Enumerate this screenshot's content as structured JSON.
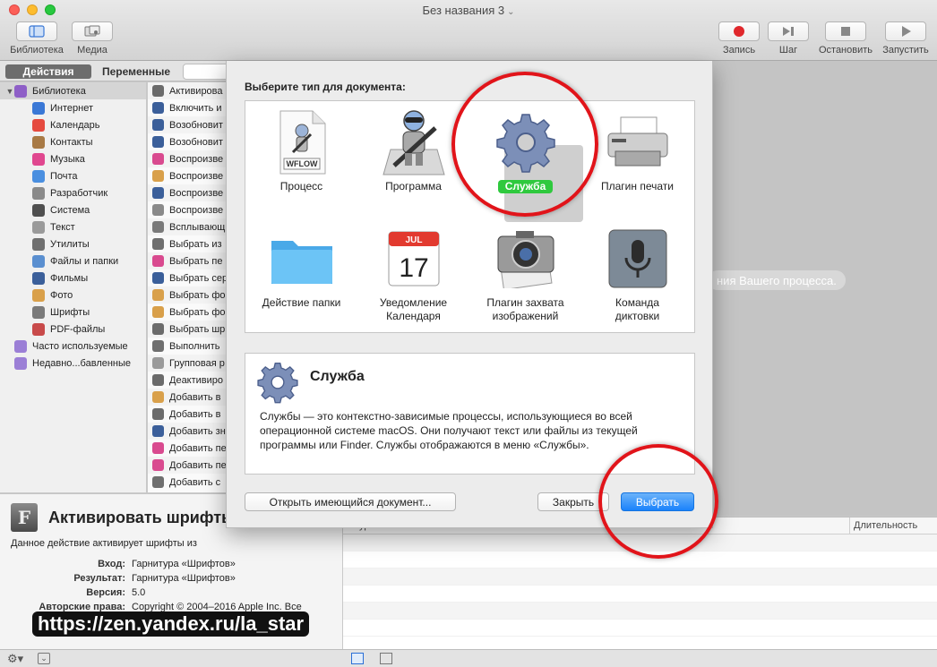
{
  "window": {
    "title": "Без названия 3"
  },
  "toolbar": {
    "library": "Библиотека",
    "media": "Медиа",
    "record": "Запись",
    "step": "Шаг",
    "stop": "Остановить",
    "run": "Запустить"
  },
  "left_tabs": {
    "actions": "Действия",
    "variables": "Переменные"
  },
  "library": {
    "items": [
      {
        "label": "Библиотека",
        "color": "#8e5fc7",
        "level": 0
      },
      {
        "label": "Интернет",
        "color": "#3a78d6",
        "level": 1
      },
      {
        "label": "Календарь",
        "color": "#e54a3f",
        "level": 1
      },
      {
        "label": "Контакты",
        "color": "#a87a45",
        "level": 1
      },
      {
        "label": "Музыка",
        "color": "#e0478f",
        "level": 1
      },
      {
        "label": "Почта",
        "color": "#4a8fe0",
        "level": 1
      },
      {
        "label": "Разработчик",
        "color": "#8a8a8a",
        "level": 1
      },
      {
        "label": "Система",
        "color": "#4f4f4f",
        "level": 1
      },
      {
        "label": "Текст",
        "color": "#9a9a9a",
        "level": 1
      },
      {
        "label": "Утилиты",
        "color": "#6f6f6f",
        "level": 1
      },
      {
        "label": "Файлы и папки",
        "color": "#5a8fd0",
        "level": 1
      },
      {
        "label": "Фильмы",
        "color": "#3b5f9a",
        "level": 1
      },
      {
        "label": "Фото",
        "color": "#d9a04a",
        "level": 1
      },
      {
        "label": "Шрифты",
        "color": "#7a7a7a",
        "level": 1
      },
      {
        "label": "PDF-файлы",
        "color": "#c84a4a",
        "level": 1
      },
      {
        "label": "Часто используемые",
        "color": "#9b7fd6",
        "level": 0
      },
      {
        "label": "Недавно...бавленные",
        "color": "#9b7fd6",
        "level": 0
      }
    ]
  },
  "actions": {
    "items": [
      {
        "label": "Активирова",
        "color": "#6b6b6b"
      },
      {
        "label": "Включить и",
        "color": "#3b5f9a"
      },
      {
        "label": "Возобновит",
        "color": "#3b5f9a"
      },
      {
        "label": "Возобновит",
        "color": "#3b5f9a"
      },
      {
        "label": "Воспроизве",
        "color": "#d94a8f"
      },
      {
        "label": "Воспроизве",
        "color": "#d9a04a"
      },
      {
        "label": "Воспроизве",
        "color": "#3b5f9a"
      },
      {
        "label": "Воспроизве",
        "color": "#8a8a8a"
      },
      {
        "label": "Всплывающ",
        "color": "#7a7a7a"
      },
      {
        "label": "Выбрать из",
        "color": "#6f6f6f"
      },
      {
        "label": "Выбрать пе",
        "color": "#d94a8f"
      },
      {
        "label": "Выбрать сер",
        "color": "#3b5f9a"
      },
      {
        "label": "Выбрать фо",
        "color": "#d9a04a"
      },
      {
        "label": "Выбрать фо",
        "color": "#d9a04a"
      },
      {
        "label": "Выбрать шр",
        "color": "#6b6b6b"
      },
      {
        "label": "Выполнить",
        "color": "#6f6f6f"
      },
      {
        "label": "Групповая р",
        "color": "#9a9a9a"
      },
      {
        "label": "Деактивиро",
        "color": "#6b6b6b"
      },
      {
        "label": "Добавить в",
        "color": "#d9a04a"
      },
      {
        "label": "Добавить в",
        "color": "#6b6b6b"
      },
      {
        "label": "Добавить зн",
        "color": "#3b5f9a"
      },
      {
        "label": "Добавить пе",
        "color": "#d94a8f"
      },
      {
        "label": "Добавить пе",
        "color": "#d94a8f"
      },
      {
        "label": "Добавить с",
        "color": "#6f6f6f"
      }
    ]
  },
  "description": {
    "title": "Активировать шрифты",
    "text": "Данное действие активирует шрифты из",
    "fields": [
      {
        "key": "Вход:",
        "value": "Гарнитура «Шрифтов»"
      },
      {
        "key": "Результат:",
        "value": "Гарнитура «Шрифтов»"
      },
      {
        "key": "Версия:",
        "value": "5.0"
      },
      {
        "key": "Авторские права:",
        "value": "Copyright © 2004–2016 Apple Inc. Все"
      }
    ]
  },
  "watermark": "https://zen.yandex.ru/la_star",
  "workflow": {
    "hint": "ния Вашего процесса."
  },
  "log": {
    "col_log": "Журнал",
    "col_duration": "Длительность"
  },
  "sheet": {
    "title": "Выберите тип для документа:",
    "types": [
      {
        "label": "Процесс",
        "badge": "WFLOW"
      },
      {
        "label": "Программа"
      },
      {
        "label": "Служба"
      },
      {
        "label": "Плагин печати"
      },
      {
        "label": "Действие папки"
      },
      {
        "label": "Уведомление\nКалендаря",
        "month": "JUL",
        "day": "17"
      },
      {
        "label": "Плагин захвата\nизображений"
      },
      {
        "label": "Команда\nдиктовки"
      }
    ],
    "selected_index": 2,
    "info": {
      "title": "Служба",
      "text": "Службы — это контекстно-зависимые процессы, использующиеся во всей операционной системе macOS. Они получают текст или файлы из текущей программы или Finder. Службы отображаются в меню «Службы»."
    },
    "open_existing": "Открыть имеющийся документ...",
    "close": "Закрыть",
    "choose": "Выбрать"
  },
  "colors": {
    "accent": "#1a82fb",
    "selection_badge": "#2fc93e",
    "annotation_ring": "#e1141a"
  }
}
